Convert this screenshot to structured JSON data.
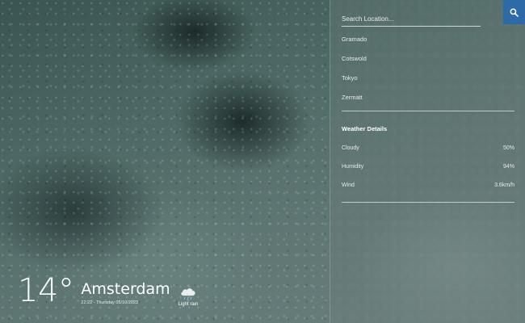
{
  "search": {
    "placeholder": "Search Location...",
    "button_icon": "search-icon"
  },
  "locations": [
    {
      "label": "Gramado"
    },
    {
      "label": "Cotswold"
    },
    {
      "label": "Tokyo"
    },
    {
      "label": "Zermatt"
    }
  ],
  "details": {
    "title": "Weather Details",
    "rows": [
      {
        "label": "Cloudy",
        "value": "50%"
      },
      {
        "label": "Humidity",
        "value": "94%"
      },
      {
        "label": "Wind",
        "value": "3.6km/h"
      }
    ]
  },
  "current": {
    "temperature": "14°",
    "city": "Amsterdam",
    "datetime": "22:22 - Thursday 05/10/2023",
    "condition_icon": "rain-cloud-icon",
    "condition": "Light rain"
  },
  "colors": {
    "accent": "#2f6aa8",
    "text": "#ffffff"
  }
}
